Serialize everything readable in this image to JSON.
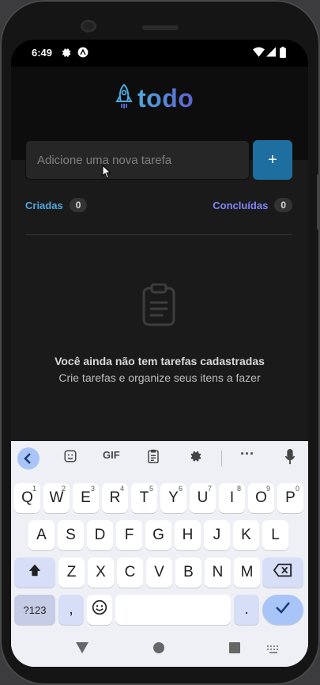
{
  "status": {
    "time": "6:49"
  },
  "app": {
    "logo_text": "todo",
    "input_placeholder": "Adicione uma nova tarefa",
    "add_button": "+",
    "created_label": "Criadas",
    "created_count": "0",
    "done_label": "Concluídas",
    "done_count": "0",
    "empty_title": "Você ainda não tem tarefas cadastradas",
    "empty_subtitle": "Crie tarefas e organize seus itens a fazer"
  },
  "colors": {
    "blue": "#4ea8de",
    "purple": "#8284fa",
    "button": "#1e6f9f"
  },
  "keyboard": {
    "toolbar": {
      "gif": "GIF"
    },
    "row1": [
      {
        "k": "Q",
        "s": "1"
      },
      {
        "k": "W",
        "s": "2"
      },
      {
        "k": "E",
        "s": "3"
      },
      {
        "k": "R",
        "s": "4"
      },
      {
        "k": "T",
        "s": "5"
      },
      {
        "k": "Y",
        "s": "6"
      },
      {
        "k": "U",
        "s": "7"
      },
      {
        "k": "I",
        "s": "8"
      },
      {
        "k": "O",
        "s": "9"
      },
      {
        "k": "P",
        "s": "0"
      }
    ],
    "row2": [
      "A",
      "S",
      "D",
      "F",
      "G",
      "H",
      "J",
      "K",
      "L"
    ],
    "row3": [
      "Z",
      "X",
      "C",
      "V",
      "B",
      "N",
      "M"
    ],
    "sym": "?123",
    "comma": ",",
    "period": "."
  }
}
